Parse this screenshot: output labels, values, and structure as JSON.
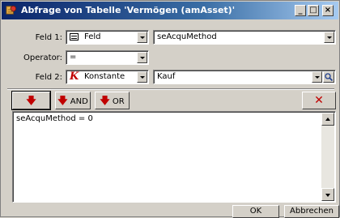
{
  "window": {
    "title": "Abfrage von Tabelle 'Vermögen (amAsset)'",
    "controls": {
      "minimize": "_",
      "maximize": "□",
      "close": "×"
    }
  },
  "row1": {
    "label": "Feld 1:",
    "type_value": "Feld",
    "type_icon": "field-icon",
    "field_value": "seAcquMethod"
  },
  "row2": {
    "label": "Operator:",
    "value": "="
  },
  "row3": {
    "label": "Feld 2:",
    "type_value": "Konstante",
    "type_icon": "constant-k-icon",
    "value": "Kauf",
    "search_icon": "magnifier-icon"
  },
  "toolbar": {
    "insert_icon": "red-down-arrow-icon",
    "and_label": "AND",
    "or_label": "OR",
    "delete_icon": "close-icon"
  },
  "expression": "seAcquMethod = 0",
  "footer": {
    "ok_label": "OK",
    "cancel_label": "Abbrechen"
  },
  "colors": {
    "titlebar_start": "#0a246a",
    "titlebar_end": "#a6caf0",
    "accent_red": "#c00000",
    "face": "#d4d0c8"
  }
}
